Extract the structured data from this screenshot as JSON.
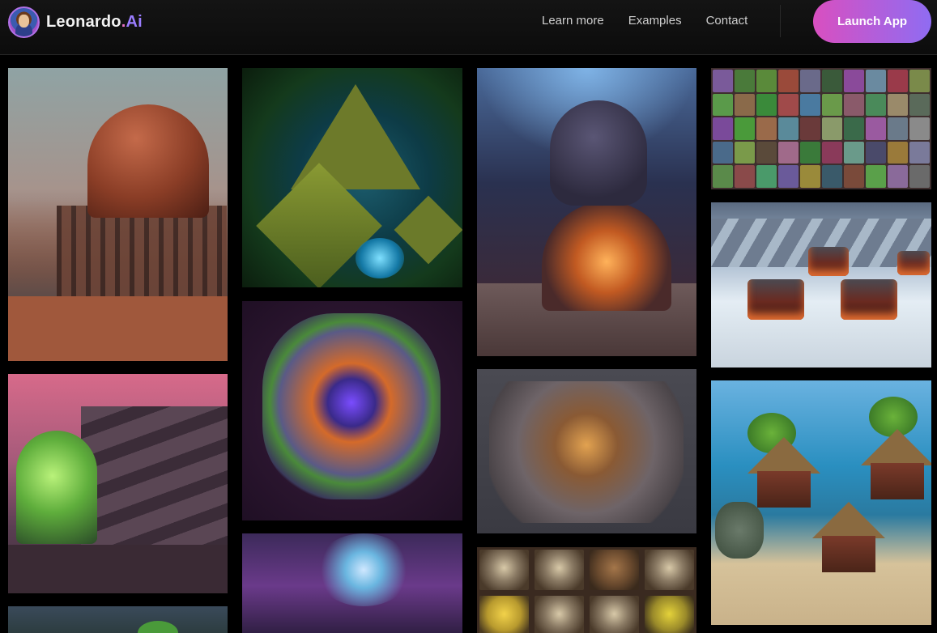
{
  "header": {
    "brand": {
      "word": "Leonardo",
      "dot": ".",
      "ai": "Ai"
    },
    "nav": [
      {
        "label": "Learn more"
      },
      {
        "label": "Examples"
      },
      {
        "label": "Contact"
      }
    ],
    "cta_label": "Launch App"
  },
  "colors": {
    "background": "#000000",
    "header_bg": "#121212",
    "cta_gradient_start": "#d94fc0",
    "cta_gradient_end": "#8f6cf2",
    "brand_dot": "#e870c5",
    "brand_ai": "#9b7dff"
  },
  "gallery": {
    "columns": 4,
    "images": [
      {
        "name": "steampunk-dome-image"
      },
      {
        "name": "jungle-pyramid-image"
      },
      {
        "name": "scifi-pod-image"
      },
      {
        "name": "character-grid-image"
      },
      {
        "name": "snow-village-image"
      },
      {
        "name": "factory-tanks-image"
      },
      {
        "name": "lava-crater-image"
      },
      {
        "name": "stone-ruins-image"
      },
      {
        "name": "island-huts-image"
      },
      {
        "name": "purple-portal-image"
      },
      {
        "name": "cat-portraits-image"
      },
      {
        "name": "green-creature-image"
      }
    ]
  }
}
